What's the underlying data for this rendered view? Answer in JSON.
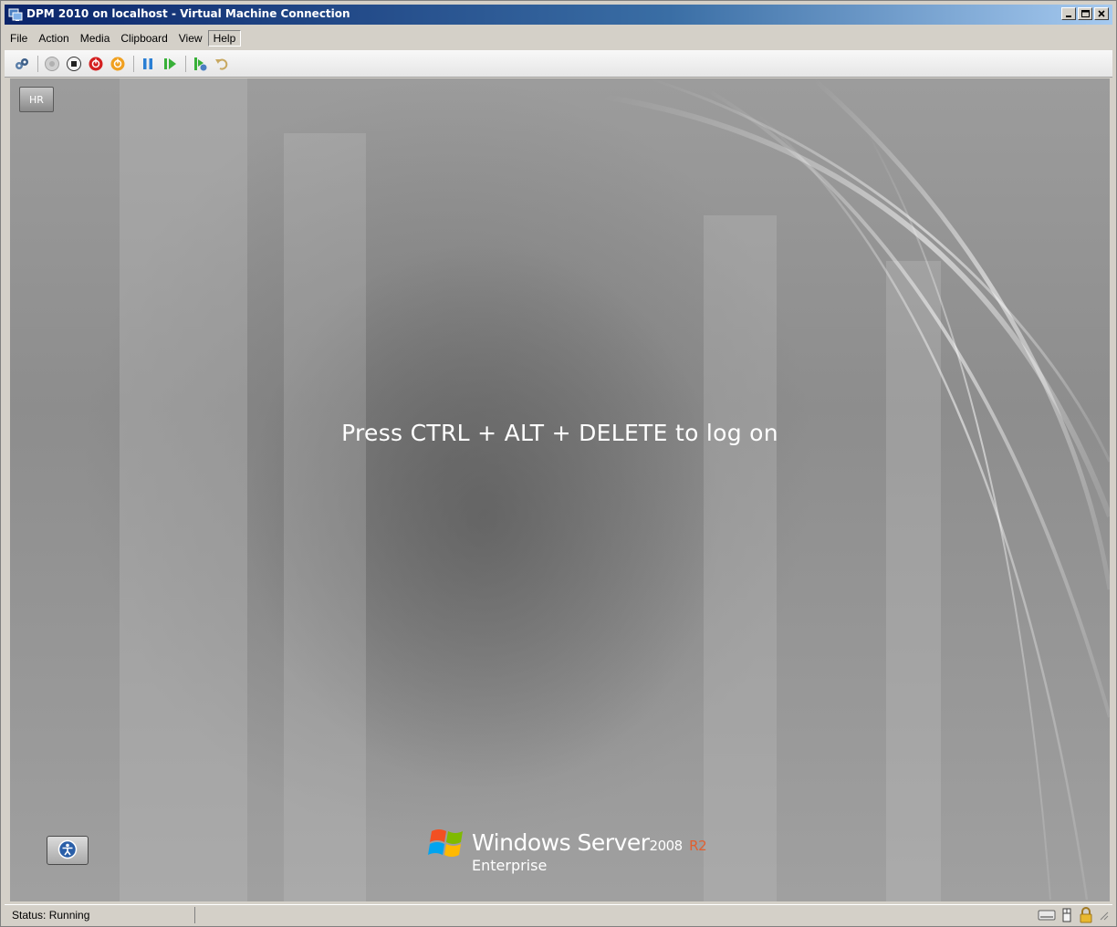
{
  "window": {
    "title": "DPM 2010 on localhost - Virtual Machine Connection",
    "icon": "vm-connection-icon",
    "caption_buttons": [
      "minimize-icon",
      "maximize-icon",
      "close-icon"
    ]
  },
  "menu": {
    "items": [
      "File",
      "Action",
      "Media",
      "Clipboard",
      "View",
      "Help"
    ],
    "active": "Help"
  },
  "toolbar": {
    "icons": [
      "ctrl-alt-del-icon",
      "start-icon",
      "turn-off-icon",
      "shut-down-icon",
      "save-icon",
      "pause-icon",
      "resume-icon",
      "snapshot-icon",
      "revert-icon"
    ]
  },
  "vm": {
    "keyboard_layout_badge": "HR",
    "logon_message": "Press CTRL + ALT + DELETE to log on",
    "brand": {
      "product": "Windows Server",
      "version": "2008",
      "revision": "R2",
      "edition": "Enterprise"
    },
    "ease_of_access_icon": "ease-of-access-icon"
  },
  "status": {
    "text": "Status: Running",
    "tray_icons": [
      "disk-icon",
      "mouse-icon",
      "lock-icon"
    ]
  },
  "colors": {
    "titlebar_start": "#0a246a",
    "titlebar_end": "#a6caf0",
    "accent_r2": "#e06030",
    "chrome": "#d4d0c8"
  }
}
